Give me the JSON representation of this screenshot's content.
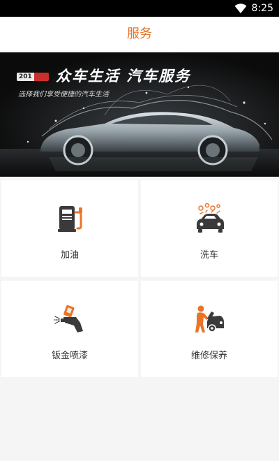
{
  "status_bar": {
    "time": "8:25",
    "icons": [
      "wifi-icon"
    ]
  },
  "header": {
    "title": "服务"
  },
  "banner": {
    "year": "201",
    "headline": "众车生活 汽车服务",
    "subline": "选择我们享受便捷的汽车生活"
  },
  "services": [
    {
      "label": "加油",
      "icon": "fuel-pump-icon"
    },
    {
      "label": "洗车",
      "icon": "car-wash-icon"
    },
    {
      "label": "钣金喷漆",
      "icon": "spray-paint-icon"
    },
    {
      "label": "维修保养",
      "icon": "car-repair-icon"
    }
  ],
  "colors": {
    "accent": "#e8742a",
    "icon_dark": "#3a3a3a",
    "background": "#f5f5f5"
  }
}
